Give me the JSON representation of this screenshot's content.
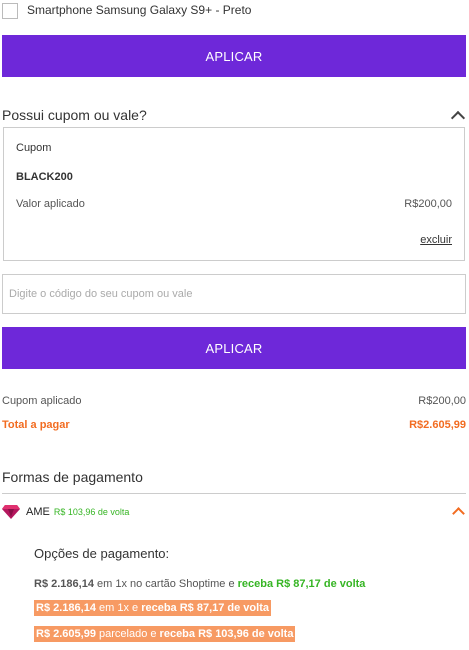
{
  "product": {
    "label": "Smartphone Samsung Galaxy S9+ - Preto",
    "checked": false
  },
  "apply_button_1": "APLICAR",
  "coupon_section": {
    "title": "Possui cupom ou vale?",
    "box_label": "Cupom",
    "code": "BLACK200",
    "valor_label": "Valor aplicado",
    "valor": "R$200,00",
    "remove_label": "excluir",
    "input_placeholder": "Digite o código do seu cupom ou vale",
    "apply_button": "APLICAR"
  },
  "summary": {
    "applied_label": "Cupom aplicado",
    "applied_value": "R$200,00",
    "total_label": "Total a pagar",
    "total_value": "R$2.605,99"
  },
  "payment": {
    "title": "Formas de pagamento",
    "method": "AME",
    "cashback": "R$ 103,96 de volta",
    "options_title": "Opções de pagamento:",
    "options": [
      {
        "amount": "R$ 2.186,14",
        "text": " em 1x no cartão Shoptime e ",
        "bonus": "receba R$ 87,17 de volta"
      },
      {
        "amount": "R$ 2.186,14",
        "text": " em 1x e ",
        "bonus": "receba R$ 87,17 de volta"
      },
      {
        "amount": "R$ 2.605,99",
        "text": " parcelado e ",
        "bonus": "receba R$ 103,96 de volta"
      }
    ]
  },
  "colors": {
    "primary": "#6e28d9",
    "orange": "#f26c21",
    "green": "#36b524",
    "highlight": "#f79a63"
  },
  "icons": {
    "collapse": "chevron-up-icon",
    "method": "ame-gem-icon"
  }
}
